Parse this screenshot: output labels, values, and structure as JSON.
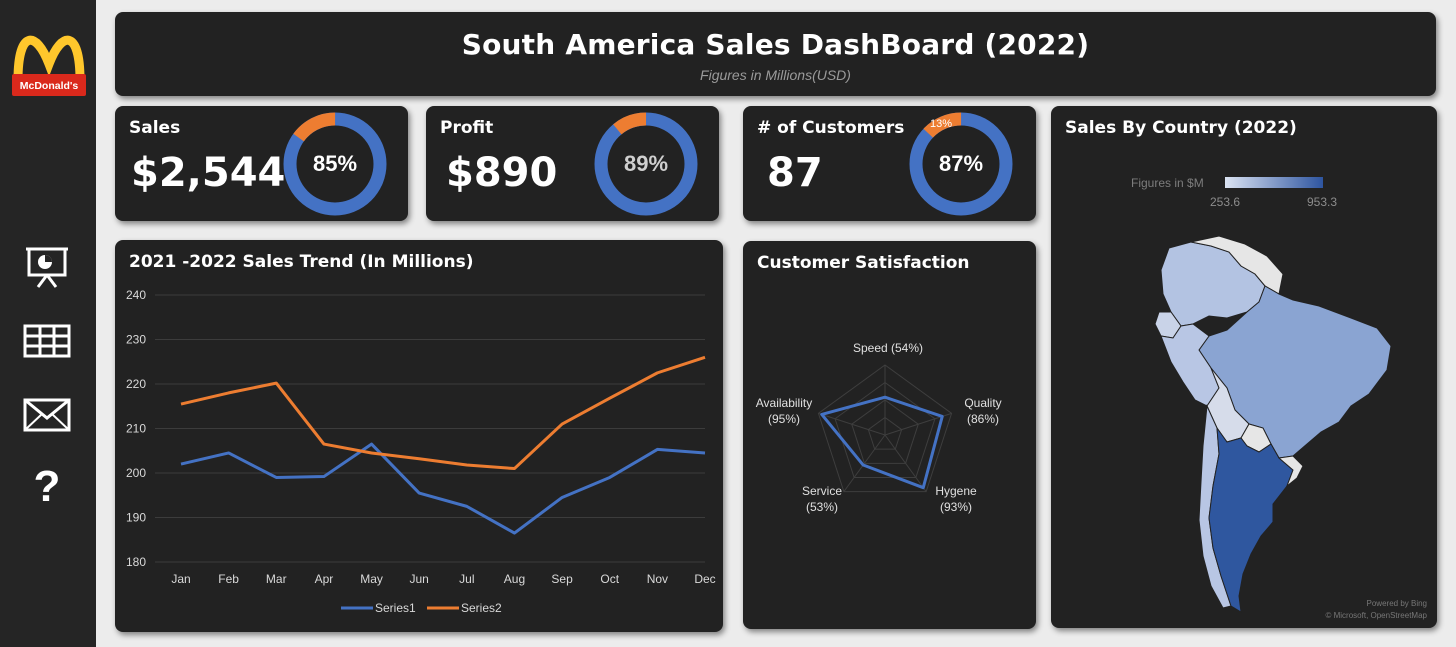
{
  "header": {
    "title": "South America Sales DashBoard (2022)",
    "subtitle": "Figures in Millions(USD)"
  },
  "sidebar": {
    "logo_text": "McDonald's",
    "items": [
      {
        "name": "presentation-icon"
      },
      {
        "name": "table-icon"
      },
      {
        "name": "mail-icon"
      },
      {
        "name": "help-icon",
        "label": "?"
      }
    ]
  },
  "kpis": {
    "sales": {
      "label": "Sales",
      "value": "$2,544",
      "percent_label": "85%",
      "percent": 0.85
    },
    "profit": {
      "label": "Profit",
      "value": "$890",
      "percent_label": "89%",
      "percent": 0.89
    },
    "customers": {
      "label": "# of Customers",
      "value": "87",
      "percent_label": "87%",
      "percent": 0.87,
      "remainder_label": "13%"
    }
  },
  "colors": {
    "blue": "#4472c4",
    "orange": "#ed7d31",
    "card": "#222222"
  },
  "trend": {
    "title": "2021 -2022 Sales Trend (In Millions)",
    "chart_data": {
      "type": "line",
      "categories": [
        "Jan",
        "Feb",
        "Mar",
        "Apr",
        "May",
        "Jun",
        "Jul",
        "Aug",
        "Sep",
        "Oct",
        "Nov",
        "Dec"
      ],
      "series": [
        {
          "name": "Series1",
          "values": [
            202,
            204.5,
            199,
            199.2,
            206.5,
            195.5,
            192.5,
            186.5,
            194.5,
            199,
            205.3,
            204.5
          ]
        },
        {
          "name": "Series2",
          "values": [
            215.5,
            218,
            220.2,
            206.5,
            204.5,
            203.2,
            201.8,
            201,
            211,
            216.8,
            222.5,
            226
          ]
        }
      ],
      "yticks": [
        "240",
        "230",
        "220",
        "210",
        "200",
        "190",
        "180"
      ],
      "ylim": [
        180,
        240
      ],
      "grid": true,
      "legend": "bottom"
    }
  },
  "satisfaction": {
    "title": "Customer Satisfaction",
    "chart_data": {
      "type": "radar",
      "axes": [
        {
          "label": "Speed (54%)",
          "value": 54
        },
        {
          "label": "Quality",
          "pct": "(86%)",
          "value": 86
        },
        {
          "label": "Hygene",
          "pct": "(93%)",
          "value": 93
        },
        {
          "label": "Service",
          "pct": "(53%)",
          "value": 53
        },
        {
          "label": "Availability",
          "pct": "(95%)",
          "value": 95
        }
      ],
      "max": 100
    }
  },
  "map": {
    "title": "Sales By Country (2022)",
    "legend_label": "Figures in $M",
    "min_label": "253.6",
    "max_label": "953.3",
    "credit1": "Powered by Bing",
    "credit2": "© Microsoft, OpenStreetMap"
  }
}
